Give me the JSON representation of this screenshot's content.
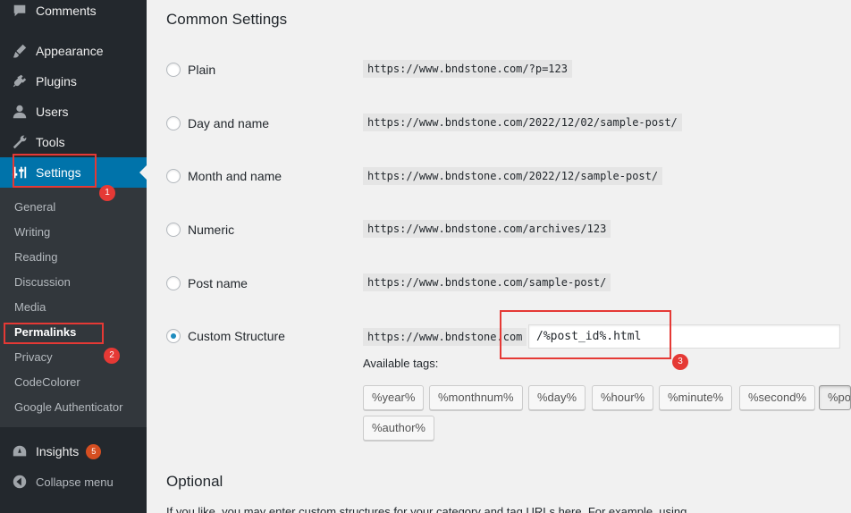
{
  "sidebar": {
    "menu": [
      {
        "label": "Comments",
        "icon": "comment-icon"
      },
      {
        "label": "Appearance",
        "icon": "brush-icon"
      },
      {
        "label": "Plugins",
        "icon": "plug-icon"
      },
      {
        "label": "Users",
        "icon": "user-icon"
      },
      {
        "label": "Tools",
        "icon": "wrench-icon"
      },
      {
        "label": "Settings",
        "icon": "settings-sliders-icon"
      }
    ],
    "submenu": [
      "General",
      "Writing",
      "Reading",
      "Discussion",
      "Media",
      "Permalinks",
      "Privacy",
      "CodeColorer",
      "Google Authenticator"
    ],
    "insights": {
      "label": "Insights",
      "badge": "5"
    },
    "collapse": "Collapse menu",
    "accent_color": "#0073aa"
  },
  "annotations": [
    "1",
    "2",
    "3"
  ],
  "main": {
    "common_title": "Common Settings",
    "options": [
      {
        "label": "Plain",
        "example": "https://www.bndstone.com/?p=123",
        "checked": false
      },
      {
        "label": "Day and name",
        "example": "https://www.bndstone.com/2022/12/02/sample-post/",
        "checked": false
      },
      {
        "label": "Month and name",
        "example": "https://www.bndstone.com/2022/12/sample-post/",
        "checked": false
      },
      {
        "label": "Numeric",
        "example": "https://www.bndstone.com/archives/123",
        "checked": false
      },
      {
        "label": "Post name",
        "example": "https://www.bndstone.com/sample-post/",
        "checked": false
      },
      {
        "label": "Custom Structure",
        "example": "https://www.bndstone.com",
        "checked": true
      }
    ],
    "custom_value": "/%post_id%.html",
    "tags_label": "Available tags:",
    "tags": [
      "%year%",
      "%monthnum%",
      "%day%",
      "%hour%",
      "%minute%",
      "%second%",
      "%po",
      "%author%"
    ],
    "optional_title": "Optional",
    "optional_desc": "If you like, you may enter custom structures for your category and tag URLs here. For example, using"
  }
}
